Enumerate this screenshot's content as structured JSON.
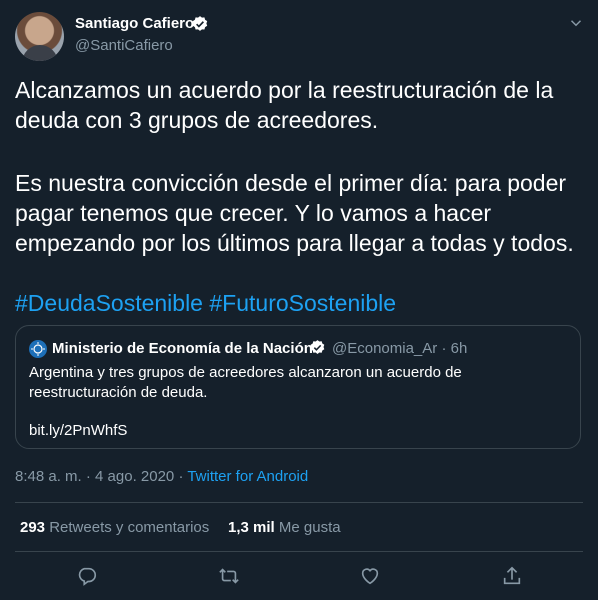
{
  "author": {
    "display_name": "Santiago Cafiero",
    "handle": "@SantiCafiero"
  },
  "tweet": {
    "paragraph_1": "Alcanzamos un acuerdo por la reestructuración de la deuda con 3 grupos de acreedores.",
    "paragraph_2": "Es nuestra convicción desde el primer día: para poder pagar tenemos que crecer. Y lo vamos a hacer empezando por los últimos para llegar a todas y todos.",
    "hashtags": [
      "#DeudaSostenible",
      "#FuturoSostenible"
    ]
  },
  "quoted": {
    "display_name": "Ministerio de Economía de la Nación",
    "handle_time": "@Economia_Ar · 6h",
    "text": "Argentina y tres grupos de acreedores alcanzaron un acuerdo de reestructuración de deuda.",
    "link": "bit.ly/2PnWhfS"
  },
  "meta": {
    "timestamp": "8:48 a. m. · 4 ago. 2020 · ",
    "source": "Twitter for Android"
  },
  "stats": {
    "retweets_count": "293",
    "retweets_label": "Retweets y comentarios",
    "likes_count": "1,3 mil",
    "likes_label": "Me gusta"
  },
  "icons": {
    "verified": "verified-badge-icon",
    "caret": "chevron-down-icon",
    "reply": "reply-icon",
    "retweet": "retweet-icon",
    "like": "heart-icon",
    "share": "share-icon"
  },
  "colors": {
    "background": "#15202b",
    "accent": "#1da1f2",
    "muted": "#8899a6",
    "border": "#38444d"
  }
}
